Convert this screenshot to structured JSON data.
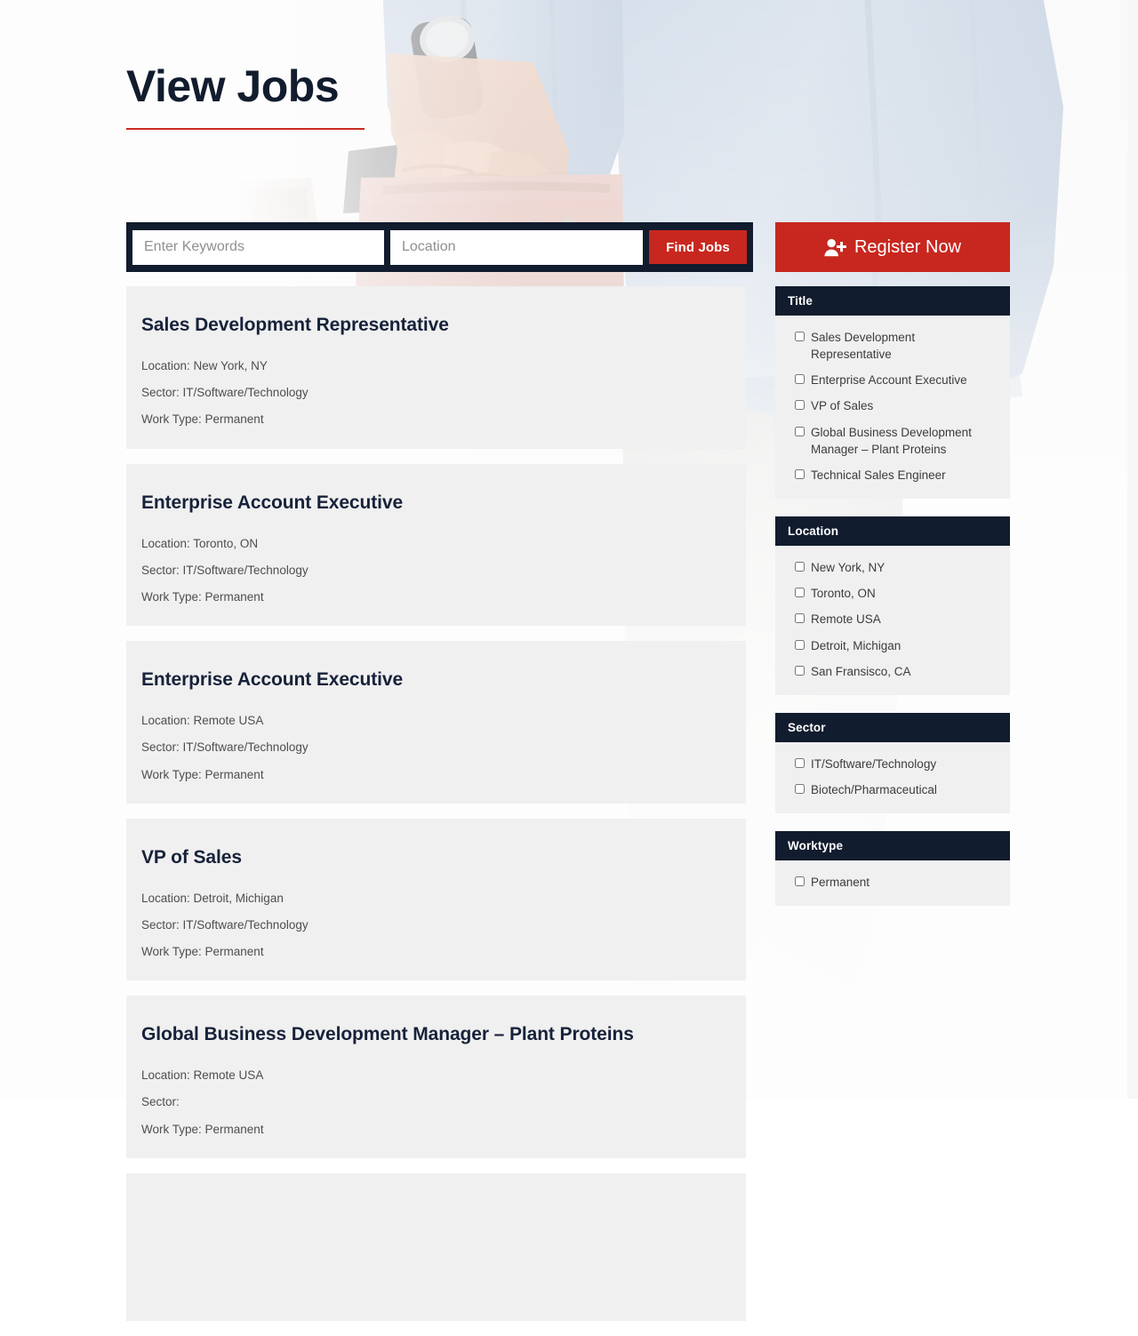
{
  "page": {
    "title": "View Jobs",
    "accent_red": "#c8271f",
    "dark_navy": "#111c2e",
    "card_bg": "#f0f0f0",
    "background_image": "businessperson-in-light-blue-blazer-holding-briefcase"
  },
  "search": {
    "keywords_placeholder": "Enter Keywords",
    "keywords_value": "",
    "location_placeholder": "Location",
    "location_value": "",
    "submit_label": "Find Jobs"
  },
  "register": {
    "label": "Register Now",
    "icon": "user-plus-icon"
  },
  "jobs": [
    {
      "title": "Sales Development Representative",
      "location": "Location: New York, NY",
      "sector": "Sector: IT/Software/Technology",
      "worktype": "Work Type: Permanent"
    },
    {
      "title": "Enterprise Account Executive",
      "location": "Location: Toronto, ON",
      "sector": "Sector: IT/Software/Technology",
      "worktype": "Work Type: Permanent"
    },
    {
      "title": "Enterprise Account Executive",
      "location": "Location: Remote USA",
      "sector": "Sector: IT/Software/Technology",
      "worktype": "Work Type: Permanent"
    },
    {
      "title": "VP of Sales",
      "location": "Location: Detroit, Michigan",
      "sector": "Sector: IT/Software/Technology",
      "worktype": "Work Type: Permanent"
    },
    {
      "title": "Global Business Development Manager – Plant Proteins",
      "location": "Location: Remote USA",
      "sector": "Sector:",
      "worktype": "Work Type: Permanent"
    },
    {
      "title": "",
      "location": "",
      "sector": "",
      "worktype": ""
    }
  ],
  "filters": [
    {
      "heading": "Title",
      "options": [
        "Sales Development Representative",
        "Enterprise Account Executive",
        "VP of Sales",
        "Global Business Development Manager – Plant Proteins",
        "Technical Sales Engineer"
      ]
    },
    {
      "heading": "Location",
      "options": [
        "New York, NY",
        "Toronto, ON",
        "Remote USA",
        "Detroit, Michigan",
        "San Fransisco, CA"
      ]
    },
    {
      "heading": "Sector",
      "options": [
        "IT/Software/Technology",
        "Biotech/Pharmaceutical"
      ]
    },
    {
      "heading": "Worktype",
      "options": [
        "Permanent"
      ]
    }
  ]
}
